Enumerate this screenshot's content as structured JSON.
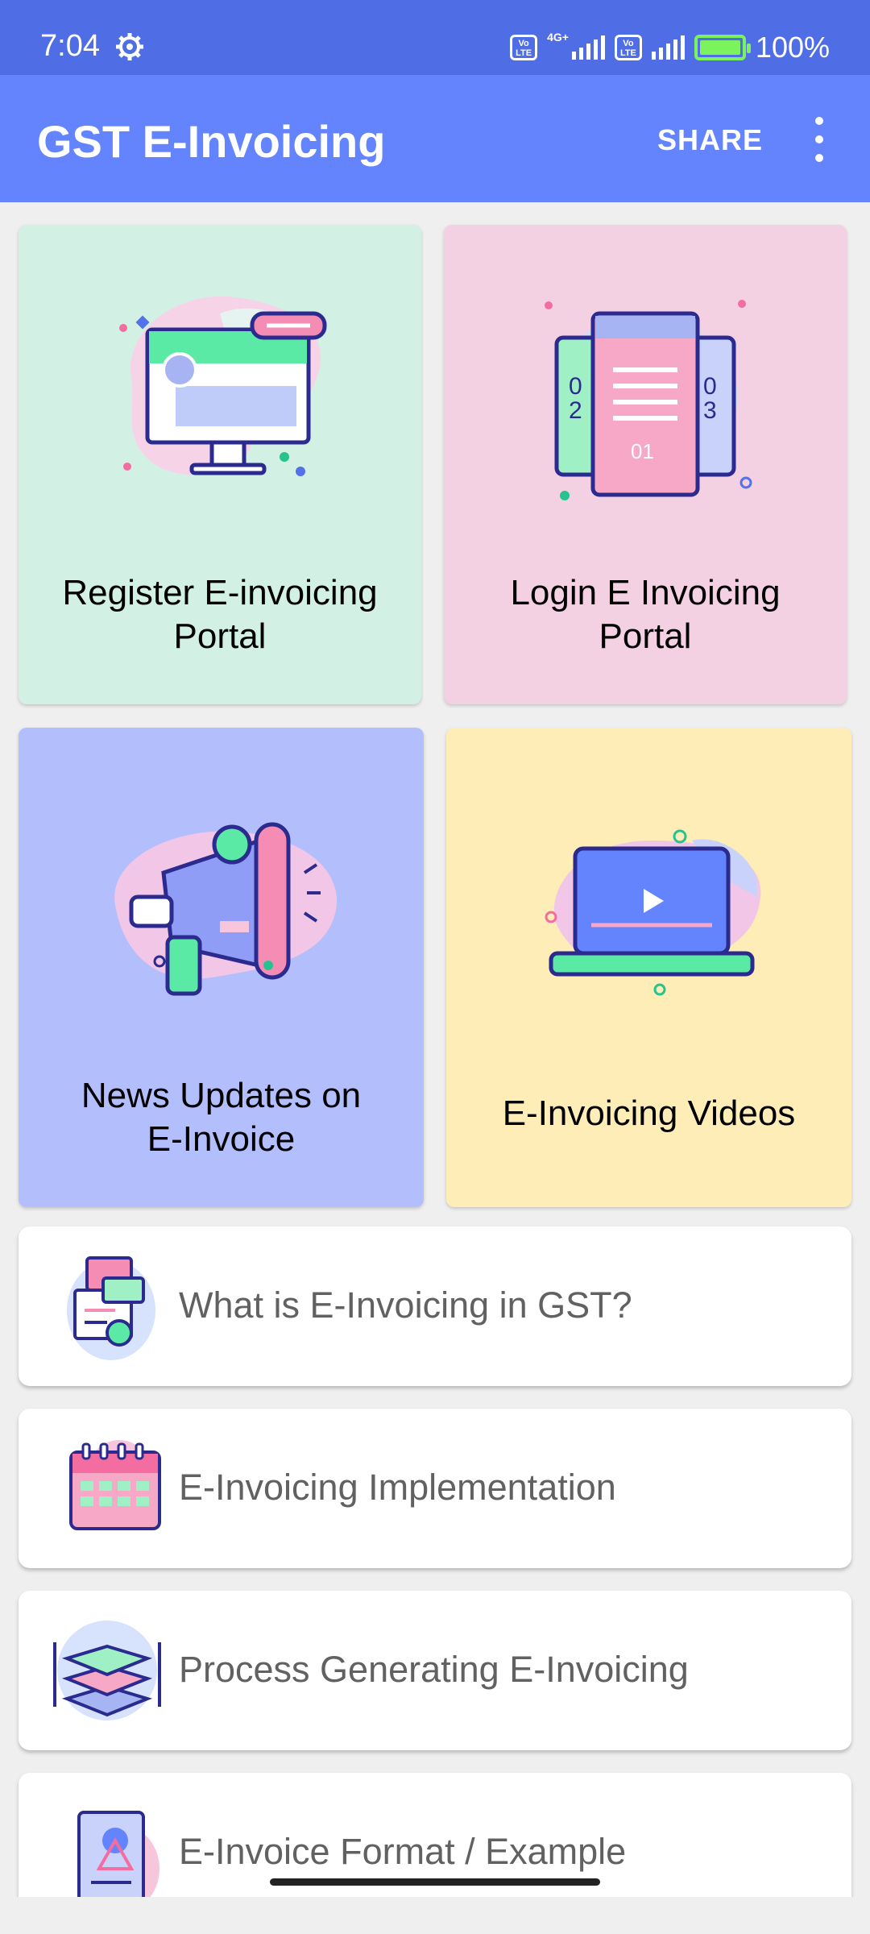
{
  "status_bar": {
    "time": "7:04",
    "volte_1": "Vo LTE",
    "network_1": "4G+",
    "volte_2": "Vo LTE",
    "battery": "100%",
    "icons": [
      "gear-icon",
      "signal-icon",
      "battery-icon"
    ]
  },
  "app_bar": {
    "title": "GST E-Invoicing",
    "share_label": "SHARE",
    "menu_icon": "more-vert-icon",
    "color": "#6384FD",
    "status_color": "#4F6EE6"
  },
  "tiles": [
    {
      "label_line1": "Register E-invoicing",
      "label_line2": "Portal",
      "bg": "#D2F0E3",
      "icon": "monitor-profile-icon"
    },
    {
      "label_line1": "Login E Invoicing",
      "label_line2": "Portal",
      "bg": "#F3D1E2",
      "icon": "documents-stack-icon"
    },
    {
      "label_line1": "News Updates on",
      "label_line2": "E-Invoice",
      "bg": "#B3BEFC",
      "icon": "megaphone-icon"
    },
    {
      "label_line1": "E-Invoicing Videos",
      "label_line2": "",
      "bg": "#FEEDB6",
      "icon": "laptop-video-icon"
    }
  ],
  "list_items": [
    {
      "label": "What is E-Invoicing in GST?",
      "icon": "invoice-coin-icon"
    },
    {
      "label": "E-Invoicing Implementation",
      "icon": "calendar-icon"
    },
    {
      "label": "Process Generating E-Invoicing",
      "icon": "layers-icon"
    },
    {
      "label": "E-Invoice Format / Example",
      "icon": "document-format-icon"
    }
  ]
}
